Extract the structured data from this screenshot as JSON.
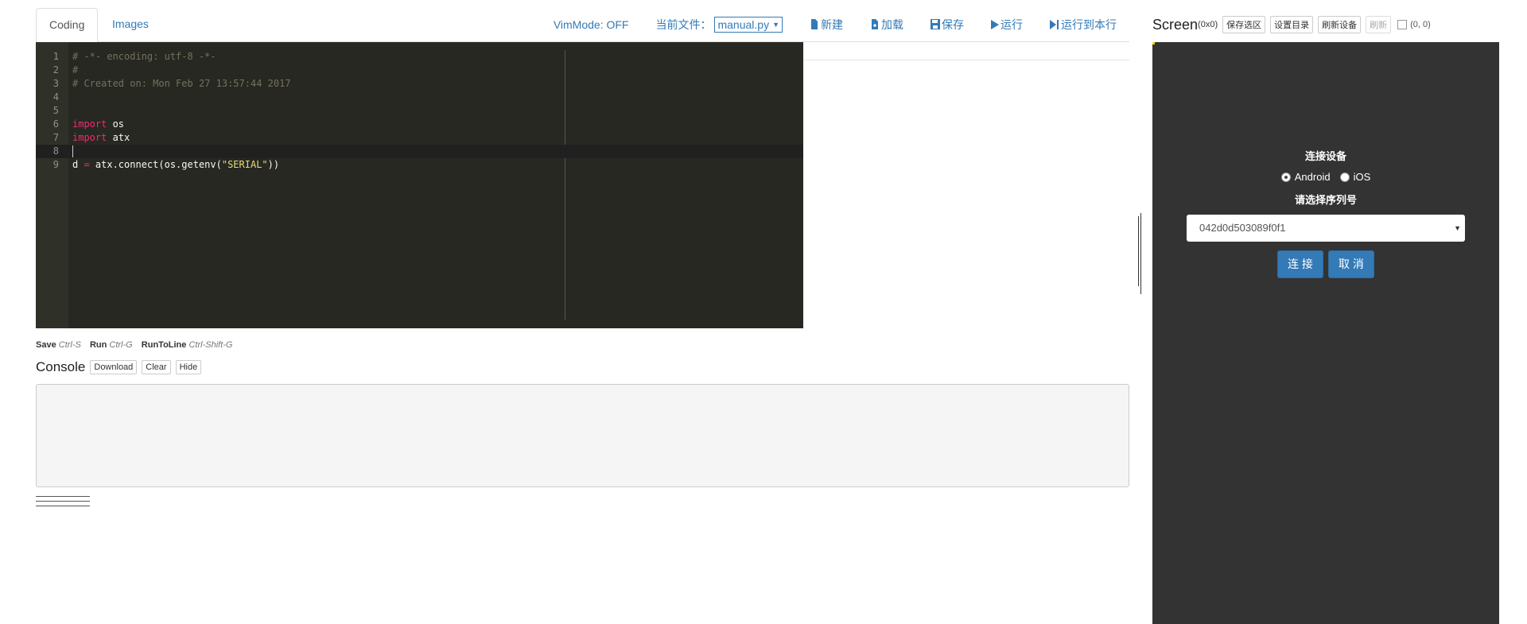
{
  "tabs": [
    {
      "label": "Coding"
    },
    {
      "label": "Images"
    }
  ],
  "toolbar": {
    "vim_mode": "VimMode: OFF",
    "current_file_label": "当前文件：",
    "current_file": "manual.py",
    "new_label": "新建",
    "load_label": "加载",
    "save_label": "保存",
    "run_label": "运行",
    "run_to_line_label": "运行到本行"
  },
  "editor": {
    "lines": [
      {
        "num": "1",
        "text": "# -*- encoding: utf-8 -*-"
      },
      {
        "num": "2",
        "text": "#"
      },
      {
        "num": "3",
        "text": "# Created on: Mon Feb 27 13:57:44 2017"
      },
      {
        "num": "4",
        "text": ""
      },
      {
        "num": "5",
        "text": ""
      },
      {
        "num": "6",
        "kw": "import",
        "rest": " os"
      },
      {
        "num": "7",
        "kw": "import",
        "rest": " atx"
      },
      {
        "num": "8",
        "text": ""
      },
      {
        "num": "9",
        "a": "d ",
        "op": "=",
        "b": " atx.connect(os.getenv(",
        "str": "\"SERIAL\"",
        "c": "))"
      }
    ]
  },
  "shortcuts": [
    {
      "name": "Save",
      "key": "Ctrl-S"
    },
    {
      "name": "Run",
      "key": "Ctrl-G"
    },
    {
      "name": "RunToLine",
      "key": "Ctrl-Shift-G"
    }
  ],
  "console": {
    "title": "Console",
    "download_label": "Download",
    "clear_label": "Clear",
    "hide_label": "Hide"
  },
  "screen": {
    "title": "Screen",
    "size": "(0x0)",
    "save_selection_label": "保存选区",
    "set_dir_label": "设置目录",
    "refresh_devices_label": "刷新设备",
    "refresh_label": "刷新",
    "coords": "(0, 0)"
  },
  "connect_dialog": {
    "title": "连接设备",
    "android_label": "Android",
    "ios_label": "iOS",
    "selected_platform": "Android",
    "serial_prompt": "请选择序列号",
    "serial_value": "042d0d503089f0f1",
    "connect_label": "连 接",
    "cancel_label": "取 消"
  },
  "colors": {
    "accent": "#337ab7",
    "editor_bg": "#272822",
    "screen_bg": "#333333"
  }
}
